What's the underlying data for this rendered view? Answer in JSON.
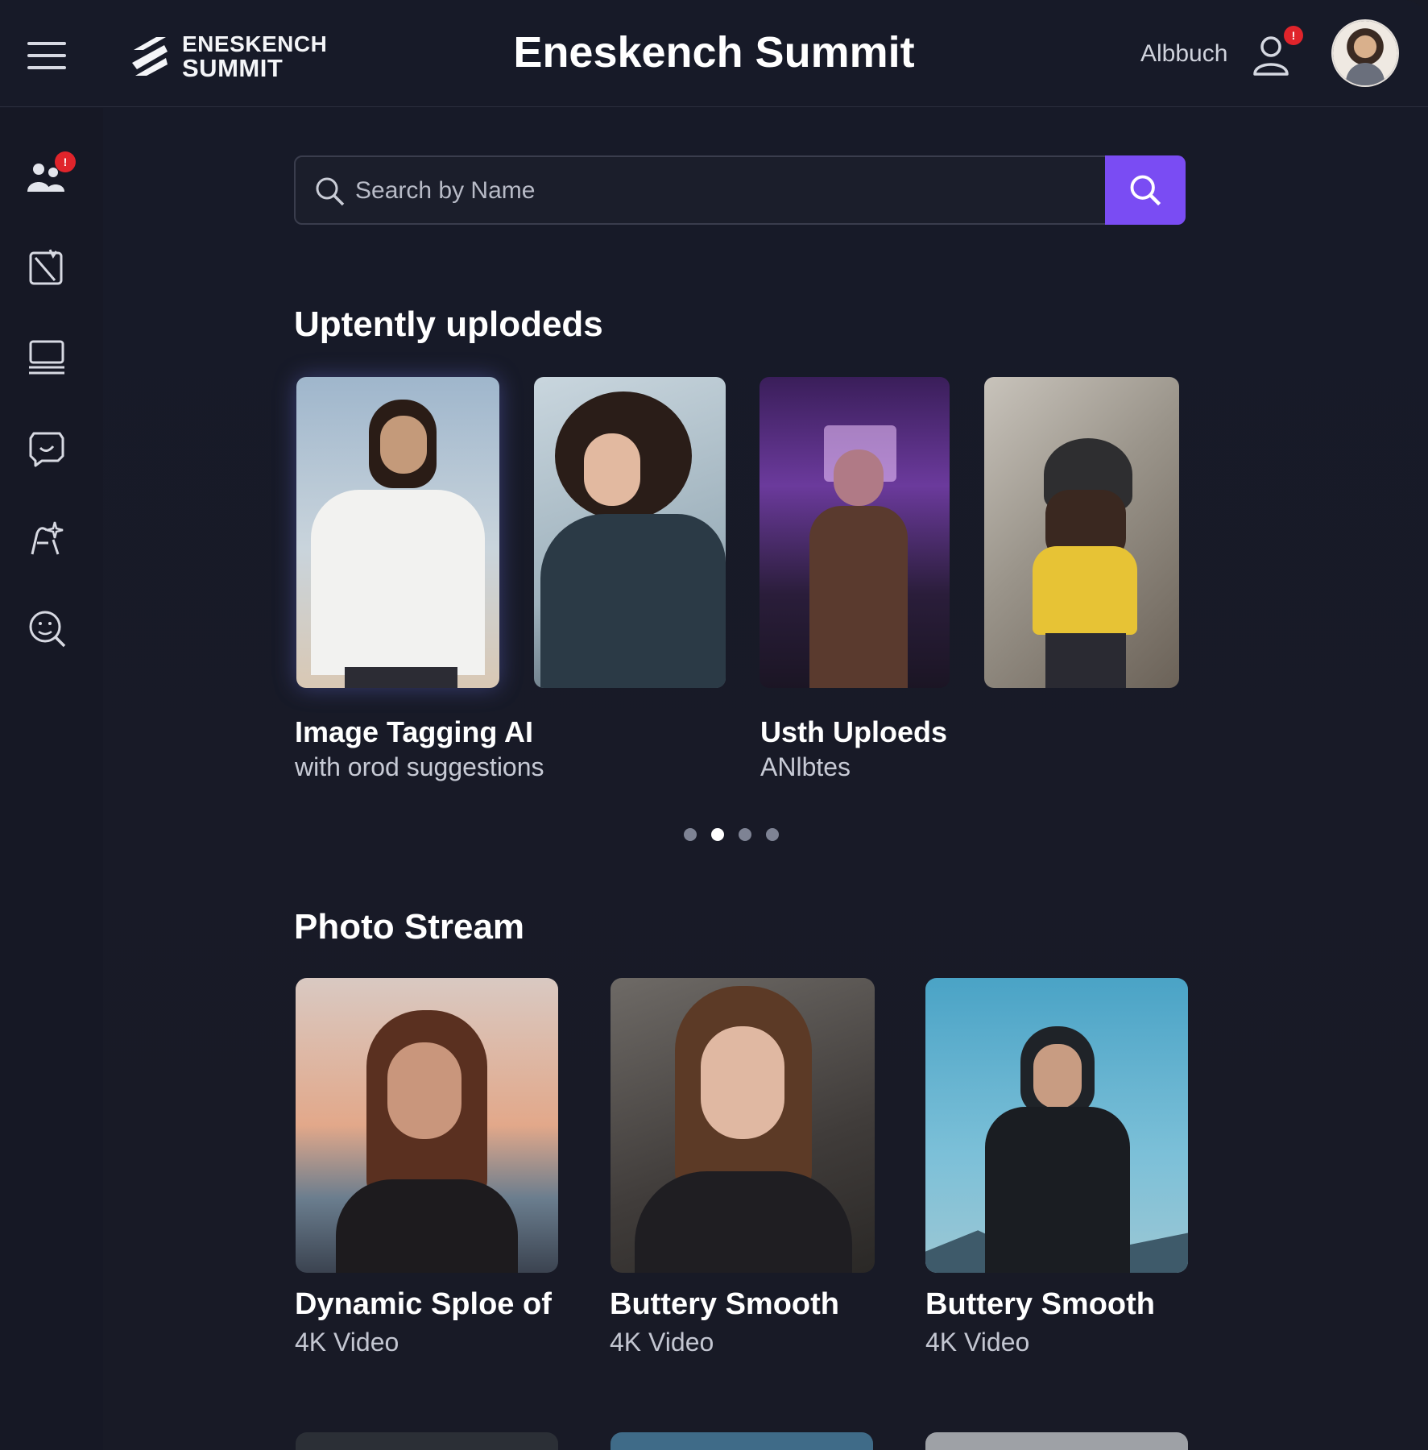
{
  "header": {
    "logo_line1": "ENESKENCH",
    "logo_line2": "SUMMIT",
    "title": "Eneskench Summit",
    "link": "Albbuch",
    "user_badge": "!"
  },
  "sidebar": {
    "items": [
      {
        "icon": "people-icon",
        "badge": "!"
      },
      {
        "icon": "edit-note-icon"
      },
      {
        "icon": "laptop-icon"
      },
      {
        "icon": "chat-bubble-icon"
      },
      {
        "icon": "magic-sparkle-icon"
      },
      {
        "icon": "face-scan-icon"
      }
    ]
  },
  "search": {
    "placeholder": "Search by Name"
  },
  "uploaded": {
    "title": "Uptently uplodeds",
    "captions": [
      {
        "title": "Image Tagging AI",
        "sub": "with orod suggestions"
      },
      {
        "title": "Usth Uploeds",
        "sub": "ANlbtes"
      }
    ],
    "carousel": {
      "pages": 4,
      "active": 2
    }
  },
  "stream": {
    "title": "Photo Stream",
    "items": [
      {
        "title": "Dynamic Sploe of",
        "sub": "4K Video"
      },
      {
        "title": "Buttery Smooth",
        "sub": "4K Video"
      },
      {
        "title": "Buttery Smooth",
        "sub": "4K Video"
      }
    ]
  },
  "colors": {
    "background": "#181a26",
    "accent": "#7a4cf3",
    "badge": "#e0242b"
  }
}
